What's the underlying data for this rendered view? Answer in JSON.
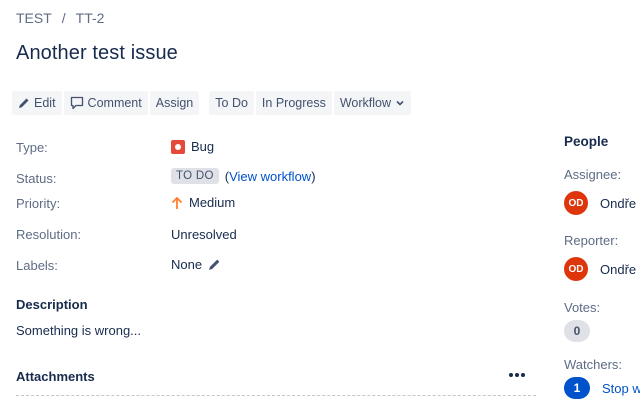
{
  "breadcrumb": {
    "project": "TEST",
    "separator": "/",
    "issue_key": "TT-2"
  },
  "issue": {
    "title": "Another test issue"
  },
  "toolbar": {
    "edit": "Edit",
    "comment": "Comment",
    "assign": "Assign",
    "todo": "To Do",
    "in_progress": "In Progress",
    "workflow": "Workflow"
  },
  "details": {
    "type_label": "Type:",
    "type_value": "Bug",
    "status_label": "Status:",
    "status_value": "TO DO",
    "view_workflow": "View workflow",
    "priority_label": "Priority:",
    "priority_value": "Medium",
    "resolution_label": "Resolution:",
    "resolution_value": "Unresolved",
    "labels_label": "Labels:",
    "labels_value": "None"
  },
  "description": {
    "title": "Description",
    "text": "Something is wrong..."
  },
  "attachments": {
    "title": "Attachments"
  },
  "people": {
    "title": "People",
    "assignee_label": "Assignee:",
    "assignee_initials": "OD",
    "assignee_name": "Ondře",
    "reporter_label": "Reporter:",
    "reporter_initials": "OD",
    "reporter_name": "Ondře",
    "votes_label": "Votes:",
    "votes_count": "0",
    "watchers_label": "Watchers:",
    "watchers_count": "1",
    "stop_watching": "Stop w"
  },
  "colors": {
    "link": "#0052cc",
    "bug": "#e5493a",
    "avatar": "#de350b",
    "priority_medium": "#ff7f2a"
  }
}
